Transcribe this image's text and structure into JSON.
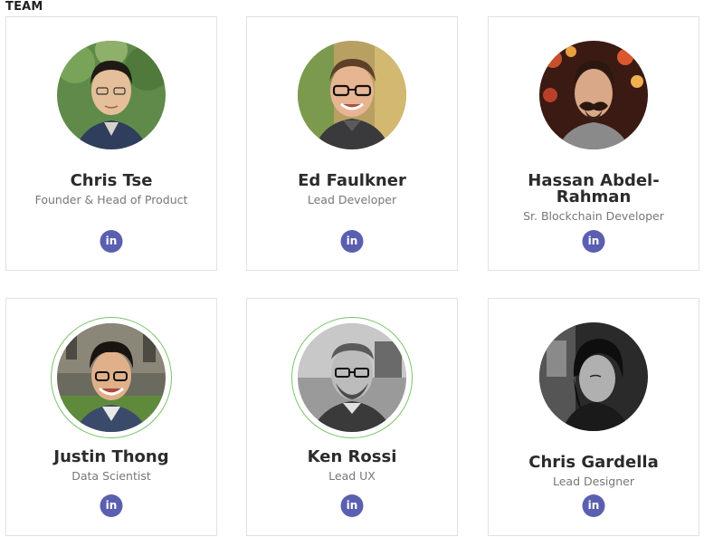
{
  "section": {
    "title": "TEAM"
  },
  "members": [
    {
      "name": "Chris Tse",
      "role": "Founder & Head of Product",
      "social": "in"
    },
    {
      "name": "Ed Faulkner",
      "role": "Lead Developer",
      "social": "in"
    },
    {
      "name": "Hassan Abdel-Rahman",
      "role": "Sr. Blockchain Developer",
      "social": "in"
    },
    {
      "name": "Justin Thong",
      "role": "Data Scientist",
      "social": "in"
    },
    {
      "name": "Ken Rossi",
      "role": "Lead UX",
      "social": "in"
    },
    {
      "name": "Chris Gardella",
      "role": "Lead Designer",
      "social": "in"
    }
  ],
  "colors": {
    "linkedin_bg": "#5b5fb0",
    "avatar_ring": "#7cc36a",
    "card_border": "#e2e2e2"
  },
  "icons": {
    "social": "linkedin-icon"
  }
}
